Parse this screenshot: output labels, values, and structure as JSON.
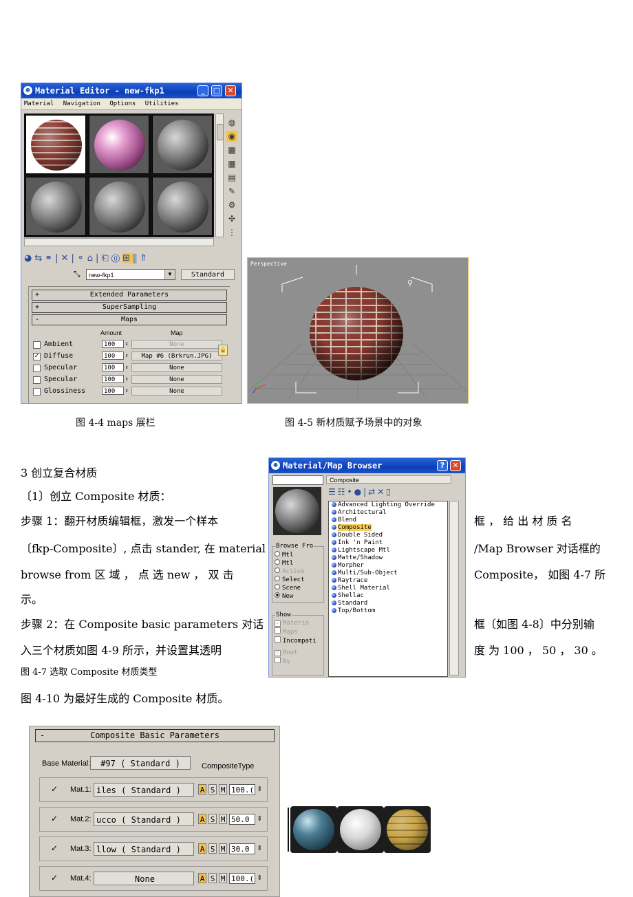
{
  "material_editor": {
    "title": "Material Editor - new-fkp1",
    "menu": [
      "Material",
      "Navigation",
      "Options",
      "Utilities"
    ],
    "material_name": "new-fkp1",
    "type_button": "Standard",
    "rollouts": [
      {
        "sign": "+",
        "label": "Extended Parameters"
      },
      {
        "sign": "+",
        "label": "SuperSampling"
      },
      {
        "sign": "-",
        "label": "Maps"
      }
    ],
    "maps_headers": {
      "amount": "Amount",
      "map": "Map"
    },
    "maps": [
      {
        "name": "Ambient",
        "checked": false,
        "amount": "100",
        "map": "None"
      },
      {
        "name": "Diffuse",
        "checked": true,
        "amount": "100",
        "map": "Map #6 (Brkrun.JPG)"
      },
      {
        "name": "Specular",
        "checked": false,
        "amount": "100",
        "map": "None"
      },
      {
        "name": "Specular",
        "checked": false,
        "amount": "100",
        "map": "None"
      },
      {
        "name": "Glossiness",
        "checked": false,
        "amount": "100",
        "map": "None"
      }
    ]
  },
  "viewport": {
    "label": "Perspective"
  },
  "captions": {
    "fig44": "图 4-4  maps 展栏",
    "fig45": "图 4-5  新材质赋予场景中的对象"
  },
  "body_text": {
    "heading": "3 创立复合材质",
    "sub1": "〔1〕创立 Composite 材质：",
    "step1_a": "步骤 1：翻开材质编辑框，激发一个样本",
    "step1_b": "〔fkp-Composite〕, 点击 stander, 在 material",
    "step1_c": "browse  from  区 域 ， 点 选  new ， 双 击",
    "step1_d": "示。",
    "right1_a": "框 ， 给 出 材 质 名",
    "right1_b": "/Map Browser 对话框的",
    "right1_c": "Composite， 如图 4-7 所",
    "step2_a": "步骤 2：在 Composite basic parameters 对话",
    "step2_b": "入三个材质如图 4-9 所示，并设置其透明",
    "right2_a": "框〔如图 4-8〕中分别输",
    "right2_b": "度 为 100 ， 50 ， 30 。",
    "fig47": "图 4-7   选取 Composite 材质类型",
    "fig410": "图 4-10 为最好生成的 Composite 材质。"
  },
  "browser": {
    "title": "Material/Map Browser",
    "path": "Composite",
    "items": [
      "Advanced Lighting Override",
      "Architectural",
      "Blend",
      "Composite",
      "Double Sided",
      "Ink 'n Paint",
      "Lightscape Mtl",
      "Matte/Shadow",
      "Morpher",
      "Multi/Sub-Object",
      "Raytrace",
      "Shell Material",
      "Shellac",
      "Standard",
      "Top/Bottom"
    ],
    "selected": "Composite",
    "browse_from": {
      "label": "Browse Fro",
      "options": [
        "Mtl",
        "Mtl",
        "Active",
        "Select",
        "Scene",
        "New"
      ],
      "selected": "New"
    },
    "show": {
      "label": "Show",
      "options": [
        "Materia",
        "Maps",
        "Incompati"
      ],
      "extra": [
        "Root",
        "By"
      ]
    }
  },
  "composite": {
    "header": "Composite Basic Parameters",
    "base_label": "Base Material:",
    "base_value": "#97  ( Standard )",
    "type_label": "CompositeType",
    "mats": [
      {
        "label": "Mat.1:",
        "value": "iles  ( Standard )",
        "amount": "100.(",
        "checked": true
      },
      {
        "label": "Mat.2:",
        "value": "ucco  ( Standard )",
        "amount": "50.0",
        "checked": true
      },
      {
        "label": "Mat.3:",
        "value": "llow  ( Standard )",
        "amount": "30.0",
        "checked": true
      },
      {
        "label": "Mat.4:",
        "value": "None",
        "amount": "100.(",
        "checked": true
      }
    ],
    "flags": [
      "A",
      "S",
      "M"
    ]
  },
  "colors": {
    "accent_yellow": "#f3c24a",
    "xp_blue": "#0a3fb8",
    "close_red": "#d9472b"
  }
}
